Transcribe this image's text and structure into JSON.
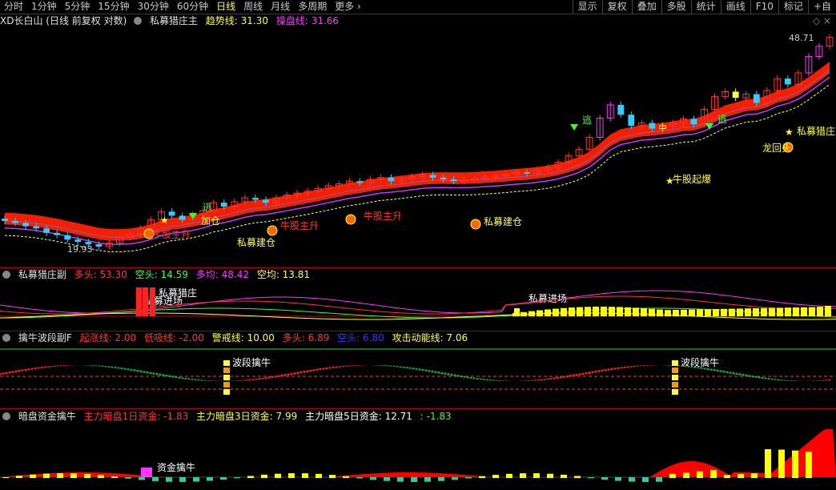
{
  "toolbar": {
    "periods": [
      "分时",
      "1分钟",
      "5分钟",
      "15分钟",
      "30分钟",
      "60分钟",
      "日线",
      "周线",
      "月线",
      "多周期",
      "更多"
    ],
    "active": "日线",
    "more_arrow": "›",
    "right": [
      "显示",
      "复权",
      "叠加",
      "多股",
      "统计",
      "画线",
      "F10",
      "标记",
      "+自"
    ]
  },
  "main_header": {
    "title": "XD长白山 (日线 前复权 对数)",
    "indicator": "私募猎庄主",
    "trend_label": "趋势线: 31.30",
    "operate_label": "操盘线: 31.66",
    "settings_icons": "◇ ×"
  },
  "price_labels": {
    "high": "48.71",
    "low": "19.93"
  },
  "annotations": {
    "escape": "逃",
    "cow_rise": "牛股主升",
    "private_buy": "私募建仓",
    "dragon_return": "龙回头",
    "bull_explode": "牛股起爆",
    "private_hunt": "私募猎庄",
    "private_enter": "私募进场",
    "band_bull": "波段擒牛",
    "fund_bull": "资金擒牛",
    "buy_cang": "加仓",
    "chuju": "牛股主升"
  },
  "sub1": {
    "title": "私募猎庄副",
    "fields": [
      {
        "text": "多头: 53.30",
        "color": "#ff3333"
      },
      {
        "text": "空头: 14.59",
        "color": "#33ff33"
      },
      {
        "text": "多均: 48.42",
        "color": "#ff33ff"
      },
      {
        "text": "空均: 13.81",
        "color": "#ffff33"
      }
    ]
  },
  "sub2": {
    "title": "擒牛波段副F",
    "fields": [
      {
        "text": "起涨线: 2.00",
        "color": "#ff3333"
      },
      {
        "text": "低吸线: -2.00",
        "color": "#ff3333"
      },
      {
        "text": "警戒线: 10.00",
        "color": "#ffff33"
      },
      {
        "text": "多头: 6.89",
        "color": "#ff3333"
      },
      {
        "text": "空头: 6.80",
        "color": "#3333ff"
      },
      {
        "text": "攻击动能线: 7.06",
        "color": "#ffff33"
      }
    ]
  },
  "sub3": {
    "title": "暗盘资金擒牛",
    "fields": [
      {
        "text": "主力暗盘1日资金: -1.83",
        "color": "#ff3333"
      },
      {
        "text": "主力暗盘3日资金: 7.99",
        "color": "#ffff33"
      },
      {
        "text": "主力暗盘5日资金: 12.71",
        "color": "#ffffff"
      },
      {
        "text": ": -1.83",
        "color": "#33ff33"
      }
    ]
  },
  "chart_data": {
    "type": "candlestick",
    "title": "XD长白山 (日线 前复权 对数)",
    "y_extremes": {
      "high": 48.71,
      "low": 19.93
    },
    "closes": [
      22.3,
      22.1,
      21.8,
      21.6,
      21.2,
      21.0,
      20.6,
      20.4,
      20.2,
      20.0,
      20.3,
      20.8,
      21.1,
      21.6,
      22.4,
      23.2,
      22.8,
      22.4,
      22.9,
      23.3,
      24.1,
      23.7,
      24.2,
      24.6,
      24.4,
      24.1,
      24.6,
      24.9,
      25.1,
      25.3,
      25.6,
      25.9,
      26.1,
      26.4,
      26.2,
      26.6,
      26.8,
      26.4,
      26.7,
      26.9,
      27.1,
      26.8,
      26.6,
      26.4,
      26.5,
      26.7,
      26.9,
      27.0,
      27.2,
      27.4,
      27.3,
      27.7,
      28.0,
      28.6,
      29.4,
      30.2,
      31.8,
      34.5,
      36.5,
      35.0,
      33.4,
      33.8,
      33.0,
      33.4,
      33.8,
      34.4,
      33.6,
      35.8,
      37.8,
      38.6,
      37.6,
      38.2,
      36.8,
      38.8,
      40.8,
      39.8,
      41.8,
      44.8,
      46.8,
      48.6
    ]
  }
}
